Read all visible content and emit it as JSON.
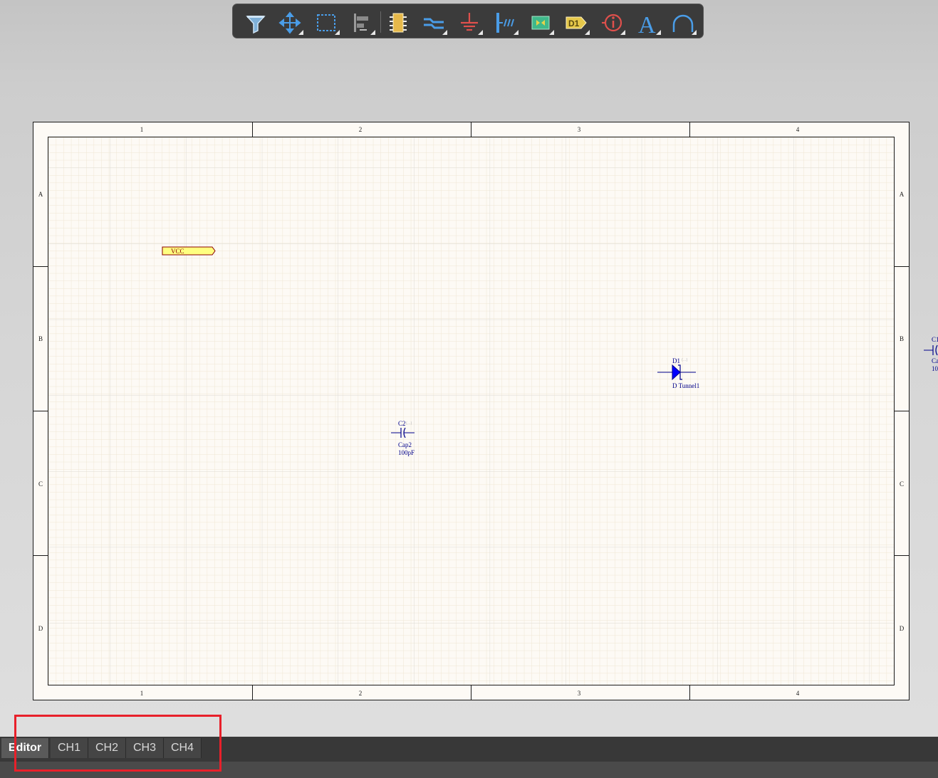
{
  "toolbar": {
    "buttons": [
      {
        "name": "filter-icon"
      },
      {
        "name": "move-icon"
      },
      {
        "name": "select-rect-icon"
      },
      {
        "name": "align-icon"
      },
      {
        "name": "place-part-icon"
      },
      {
        "name": "place-bus-wire-icon"
      },
      {
        "name": "power-port-icon"
      },
      {
        "name": "harness-icon"
      },
      {
        "name": "sheet-symbol-icon"
      },
      {
        "name": "designator-tag-icon",
        "label": "D1"
      },
      {
        "name": "directive-icon"
      },
      {
        "name": "text-icon",
        "label": "A"
      },
      {
        "name": "arc-icon"
      }
    ]
  },
  "sheet": {
    "columns": [
      "1",
      "2",
      "3",
      "4"
    ],
    "rows": [
      "A",
      "B",
      "C",
      "D"
    ]
  },
  "components": {
    "vcc": {
      "label": "VCC"
    },
    "diode": {
      "designator": "D1",
      "comment": "D Tunnel1",
      "hint": "(…)"
    },
    "cap2": {
      "designator": "C2",
      "comment": "Cap2",
      "value": "100pF",
      "hint": "(…)"
    },
    "cap1": {
      "designator": "C1",
      "comment": "Ca",
      "value": "10"
    }
  },
  "tabs": [
    {
      "label": "Editor",
      "active": true
    },
    {
      "label": "CH1"
    },
    {
      "label": "CH2"
    },
    {
      "label": "CH3"
    },
    {
      "label": "CH4"
    }
  ],
  "colors": {
    "sheet_bg": "#fdfaf5",
    "grid_minor": "#efe6d3",
    "grid_major": "#e0e0dc",
    "component": "#00008b",
    "highlight": "#e8202a"
  }
}
